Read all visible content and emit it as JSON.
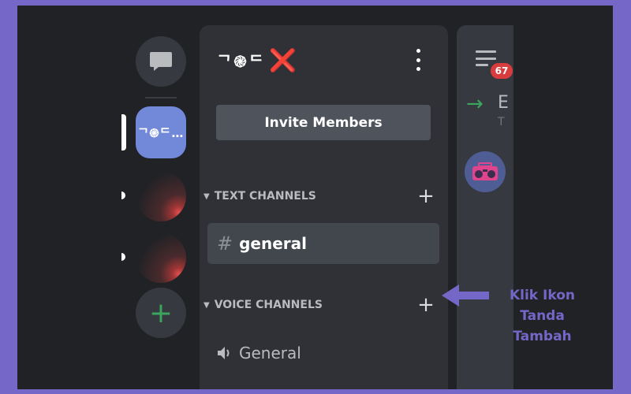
{
  "rail": {
    "dm_icon": "chat-bubble-icon",
    "server_label": "ᄀ֎ᄃ…",
    "add_server_label": "+"
  },
  "server": {
    "name": "ᄀ֎ᄃ",
    "name_mark": "❌",
    "invite_label": "Invite Members"
  },
  "categories": {
    "text": {
      "label": "TEXT CHANNELS",
      "add": "+"
    },
    "voice": {
      "label": "VOICE CHANNELS",
      "add": "+"
    }
  },
  "channels": {
    "text_hash": "#",
    "text_name": "general",
    "voice_name": "General"
  },
  "chat": {
    "notification_count": "67",
    "join_arrow": "→",
    "truncated_title": "E",
    "truncated_sub": "T"
  },
  "annotation": {
    "line1": "Klik Ikon",
    "line2": "Tanda Tambah"
  },
  "colors": {
    "background_border": "#7467c7",
    "accent_blurple": "#7289da",
    "green": "#3ba55d",
    "red_badge": "#d83c3e",
    "annotation": "#7467c7"
  }
}
